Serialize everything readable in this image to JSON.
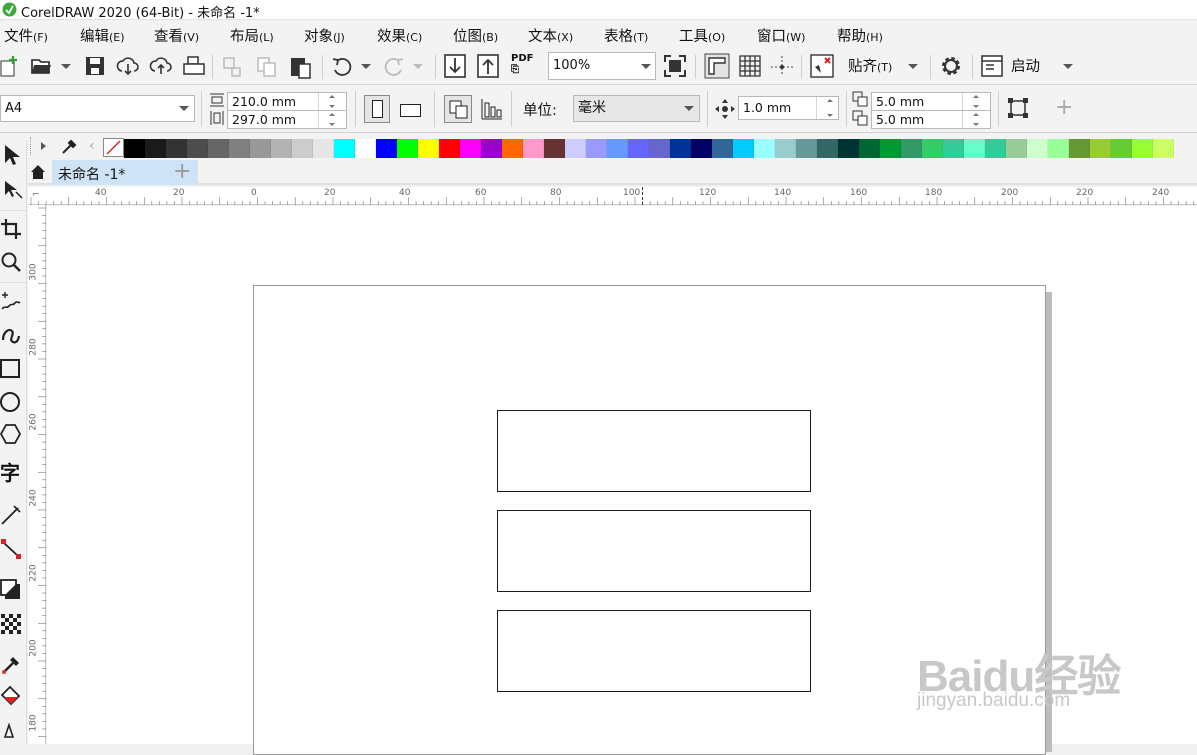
{
  "window": {
    "title": "CorelDRAW 2020 (64-Bit) - 未命名 -1*"
  },
  "menu": [
    {
      "label": "文件",
      "accel": "(F)"
    },
    {
      "label": "编辑",
      "accel": "(E)"
    },
    {
      "label": "查看",
      "accel": "(V)"
    },
    {
      "label": "布局",
      "accel": "(L)"
    },
    {
      "label": "对象",
      "accel": "(J)"
    },
    {
      "label": "效果",
      "accel": "(C)"
    },
    {
      "label": "位图",
      "accel": "(B)"
    },
    {
      "label": "文本",
      "accel": "(X)"
    },
    {
      "label": "表格",
      "accel": "(T)"
    },
    {
      "label": "工具",
      "accel": "(O)"
    },
    {
      "label": "窗口",
      "accel": "(W)"
    },
    {
      "label": "帮助",
      "accel": "(H)"
    }
  ],
  "toolbar": {
    "pdf_label": "PDF",
    "zoom": "100%",
    "snap_label": "贴齐",
    "snap_accel": "(T)",
    "launch_label": "启动"
  },
  "property_bar": {
    "page_size": "A4",
    "width": "210.0 mm",
    "height": "297.0 mm",
    "unit_label": "单位:",
    "unit_value": "毫米",
    "nudge": "1.0 mm",
    "dup_x": "5.0 mm",
    "dup_y": "5.0 mm"
  },
  "palette": {
    "colors": [
      "#000000",
      "#1a1a1a",
      "#333333",
      "#4d4d4d",
      "#666666",
      "#808080",
      "#999999",
      "#b3b3b3",
      "#cccccc",
      "#e6e6e6",
      "#00ffff",
      "#ffffff",
      "#0000ff",
      "#00ff00",
      "#ffff00",
      "#ff0000",
      "#ff00ff",
      "#9900cc",
      "#ff6600",
      "#ff99cc",
      "#663333",
      "#ccccff",
      "#9999ff",
      "#6699ff",
      "#6666ff",
      "#6666cc",
      "#003399",
      "#000066",
      "#336699",
      "#00ccff",
      "#99ffff",
      "#99cccc",
      "#669999",
      "#336666",
      "#003333",
      "#006633",
      "#009933",
      "#339966",
      "#33cc66",
      "#33cc99",
      "#66ffcc",
      "#33cc99",
      "#99cc99",
      "#ccffcc",
      "#99ff99",
      "#669933",
      "#99cc33",
      "#66cc33",
      "#99ff33",
      "#ccff66"
    ]
  },
  "tabs": [
    {
      "label": "未命名 -1*"
    }
  ],
  "ruler": {
    "top_labels": [
      "40",
      "20",
      "0",
      "20",
      "40",
      "60",
      "80",
      "100",
      "120",
      "140",
      "160",
      "180",
      "200",
      "220",
      "240"
    ],
    "left_labels": [
      "300",
      "280",
      "260",
      "240",
      "220",
      "200",
      "180"
    ]
  },
  "canvas": {
    "rectangle_count": 3
  },
  "watermark": {
    "logo": "Baidu经验",
    "url": "jingyan.baidu.com"
  }
}
